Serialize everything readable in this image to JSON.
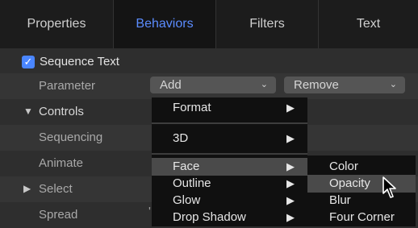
{
  "tabs": [
    {
      "label": "Properties"
    },
    {
      "label": "Behaviors"
    },
    {
      "label": "Filters"
    },
    {
      "label": "Text"
    }
  ],
  "section": {
    "title": "Sequence Text",
    "checked": true
  },
  "rows": {
    "parameter": "Parameter",
    "controls": "Controls",
    "sequencing": "Sequencing",
    "animate": "Animate",
    "select": "Select",
    "spread": "Spread"
  },
  "selects": {
    "add": "Add",
    "remove": "Remove"
  },
  "partial_value": "n ⇕",
  "menu": {
    "items": [
      {
        "label": "Format"
      },
      {
        "label": "3D"
      },
      {
        "label": "Face"
      },
      {
        "label": "Outline"
      },
      {
        "label": "Glow"
      },
      {
        "label": "Drop Shadow"
      }
    ]
  },
  "submenu": {
    "items": [
      {
        "label": "Color"
      },
      {
        "label": "Opacity"
      },
      {
        "label": "Blur"
      },
      {
        "label": "Four Corner"
      }
    ]
  },
  "colors": {
    "accent": "#5b8cff",
    "checkbox": "#4a86ff",
    "menu_bg": "#101010",
    "highlight": "#4a4a4a"
  }
}
